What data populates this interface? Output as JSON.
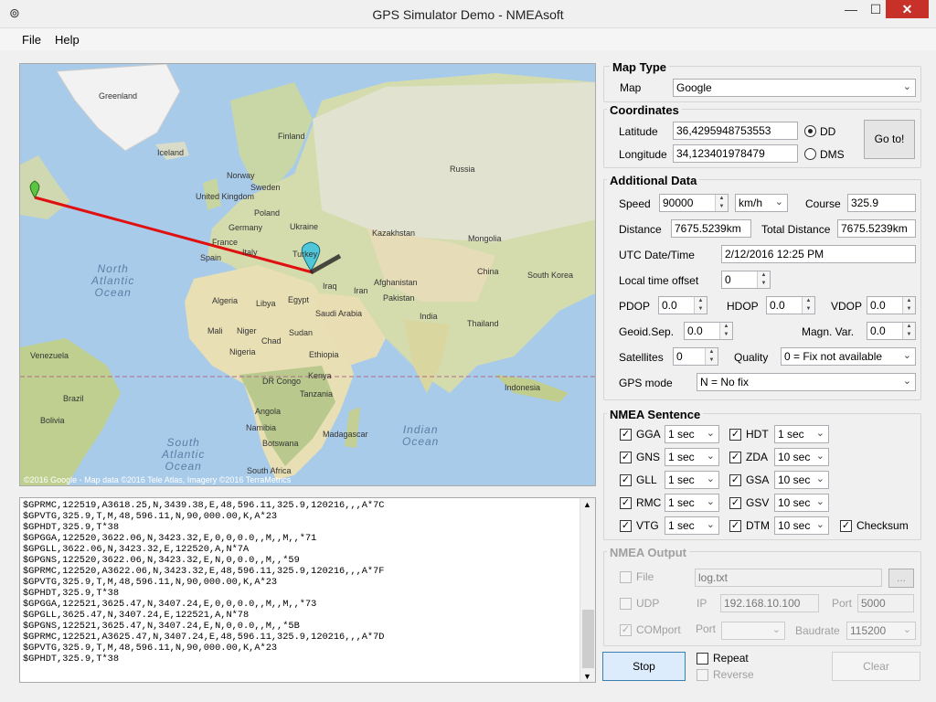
{
  "window": {
    "title": "GPS Simulator Demo - NMEAsoft",
    "min": "—",
    "max": "☐",
    "close": "✕"
  },
  "menu": [
    "File",
    "Help"
  ],
  "map": {
    "copyright": "©2016 Google - Map data ©2016 Tele Atlas, Imagery ©2016 TerraMetrics",
    "labels": [
      "Greenland",
      "Iceland",
      "Finland",
      "Norway",
      "Sweden",
      "Russia",
      "United Kingdom",
      "Poland",
      "Germany",
      "Ukraine",
      "France",
      "Italy",
      "Spain",
      "Kazakhstan",
      "Mongolia",
      "Turkey",
      "China",
      "South Korea",
      "Iran",
      "Iraq",
      "Afghanistan",
      "Pakistan",
      "Algeria",
      "Libya",
      "Egypt",
      "Saudi Arabia",
      "India",
      "Thailand",
      "Mali",
      "Niger",
      "Chad",
      "Sudan",
      "Nigeria",
      "Ethiopia",
      "Venezuela",
      "Kenya",
      "DR Congo",
      "Tanzania",
      "Indonesia",
      "Brazil",
      "Bolivia",
      "Angola",
      "Namibia",
      "Madagascar",
      "Botswana",
      "South Africa"
    ],
    "oceans": [
      "North Atlantic Ocean",
      "South Atlantic Ocean",
      "Indian Ocean"
    ]
  },
  "log_lines": [
    "$GPRMC,122519,A3618.25,N,3439.38,E,48,596.11,325.9,120216,,,A*7C",
    "$GPVTG,325.9,T,M,48,596.11,N,90,000.00,K,A*23",
    "$GPHDT,325.9,T*38",
    "$GPGGA,122520,3622.06,N,3423.32,E,0,0,0.0,,M,,M,,*71",
    "$GPGLL,3622.06,N,3423.32,E,122520,A,N*7A",
    "$GPGNS,122520,3622.06,N,3423.32,E,N,0,0.0,,M,,*59",
    "$GPRMC,122520,A3622.06,N,3423.32,E,48,596.11,325.9,120216,,,A*7F",
    "$GPVTG,325.9,T,M,48,596.11,N,90,000.00,K,A*23",
    "$GPHDT,325.9,T*38",
    "$GPGGA,122521,3625.47,N,3407.24,E,0,0,0.0,,M,,M,,*73",
    "$GPGLL,3625.47,N,3407.24,E,122521,A,N*78",
    "$GPGNS,122521,3625.47,N,3407.24,E,N,0,0.0,,M,,*5B",
    "$GPRMC,122521,A3625.47,N,3407.24,E,48,596.11,325.9,120216,,,A*7D",
    "$GPVTG,325.9,T,M,48,596.11,N,90,000.00,K,A*23",
    "$GPHDT,325.9,T*38"
  ],
  "map_type": {
    "title": "Map Type",
    "label": "Map",
    "value": "Google"
  },
  "coords": {
    "title": "Coordinates",
    "lat_label": "Latitude",
    "lat": "36,4295948753553",
    "lon_label": "Longitude",
    "lon": "34,123401978479",
    "dd": "DD",
    "dms": "DMS",
    "goto": "Go to!"
  },
  "additional": {
    "title": "Additional Data",
    "speed_label": "Speed",
    "speed": "90000",
    "speed_unit": "km/h",
    "course_label": "Course",
    "course": "325.9",
    "distance_label": "Distance",
    "distance": "7675.5239km",
    "total_label": "Total Distance",
    "total": "7675.5239km",
    "utc_label": "UTC Date/Time",
    "utc": "2/12/2016  12:25 PM",
    "lto_label": "Local time offset",
    "lto": "0",
    "pdop_label": "PDOP",
    "pdop": "0.0",
    "hdop_label": "HDOP",
    "hdop": "0.0",
    "vdop_label": "VDOP",
    "vdop": "0.0",
    "geoid_label": "Geoid.Sep.",
    "geoid": "0.0",
    "magn_label": "Magn. Var.",
    "magn": "0.0",
    "sat_label": "Satellites",
    "sat": "0",
    "quality_label": "Quality",
    "quality": "0 = Fix not available",
    "gpsmode_label": "GPS mode",
    "gpsmode": "N = No fix"
  },
  "nmea": {
    "title": "NMEA Sentence",
    "left": [
      {
        "name": "GGA",
        "rate": "1 sec"
      },
      {
        "name": "GNS",
        "rate": "1 sec"
      },
      {
        "name": "GLL",
        "rate": "1 sec"
      },
      {
        "name": "RMC",
        "rate": "1 sec"
      },
      {
        "name": "VTG",
        "rate": "1 sec"
      }
    ],
    "right": [
      {
        "name": "HDT",
        "rate": "1 sec"
      },
      {
        "name": "ZDA",
        "rate": "10 sec"
      },
      {
        "name": "GSA",
        "rate": "10 sec"
      },
      {
        "name": "GSV",
        "rate": "10 sec"
      },
      {
        "name": "DTM",
        "rate": "10 sec"
      }
    ],
    "checksum": "Checksum"
  },
  "output": {
    "title": "NMEA Output",
    "file_label": "File",
    "file": "log.txt",
    "browse": "...",
    "udp_label": "UDP",
    "ip_label": "IP",
    "ip": "192.168.10.100",
    "port_label": "Port",
    "port": "5000",
    "com_label": "COMport",
    "comport_label": "Port",
    "baud_label": "Baudrate",
    "baud": "115200"
  },
  "controls": {
    "stop": "Stop",
    "repeat": "Repeat",
    "reverse": "Reverse",
    "clear": "Clear"
  },
  "colors": {
    "route": "#e01010",
    "marker_start": "#5cc443",
    "marker_current": "#4fc7d8",
    "accent_button": "#dcecfc"
  }
}
